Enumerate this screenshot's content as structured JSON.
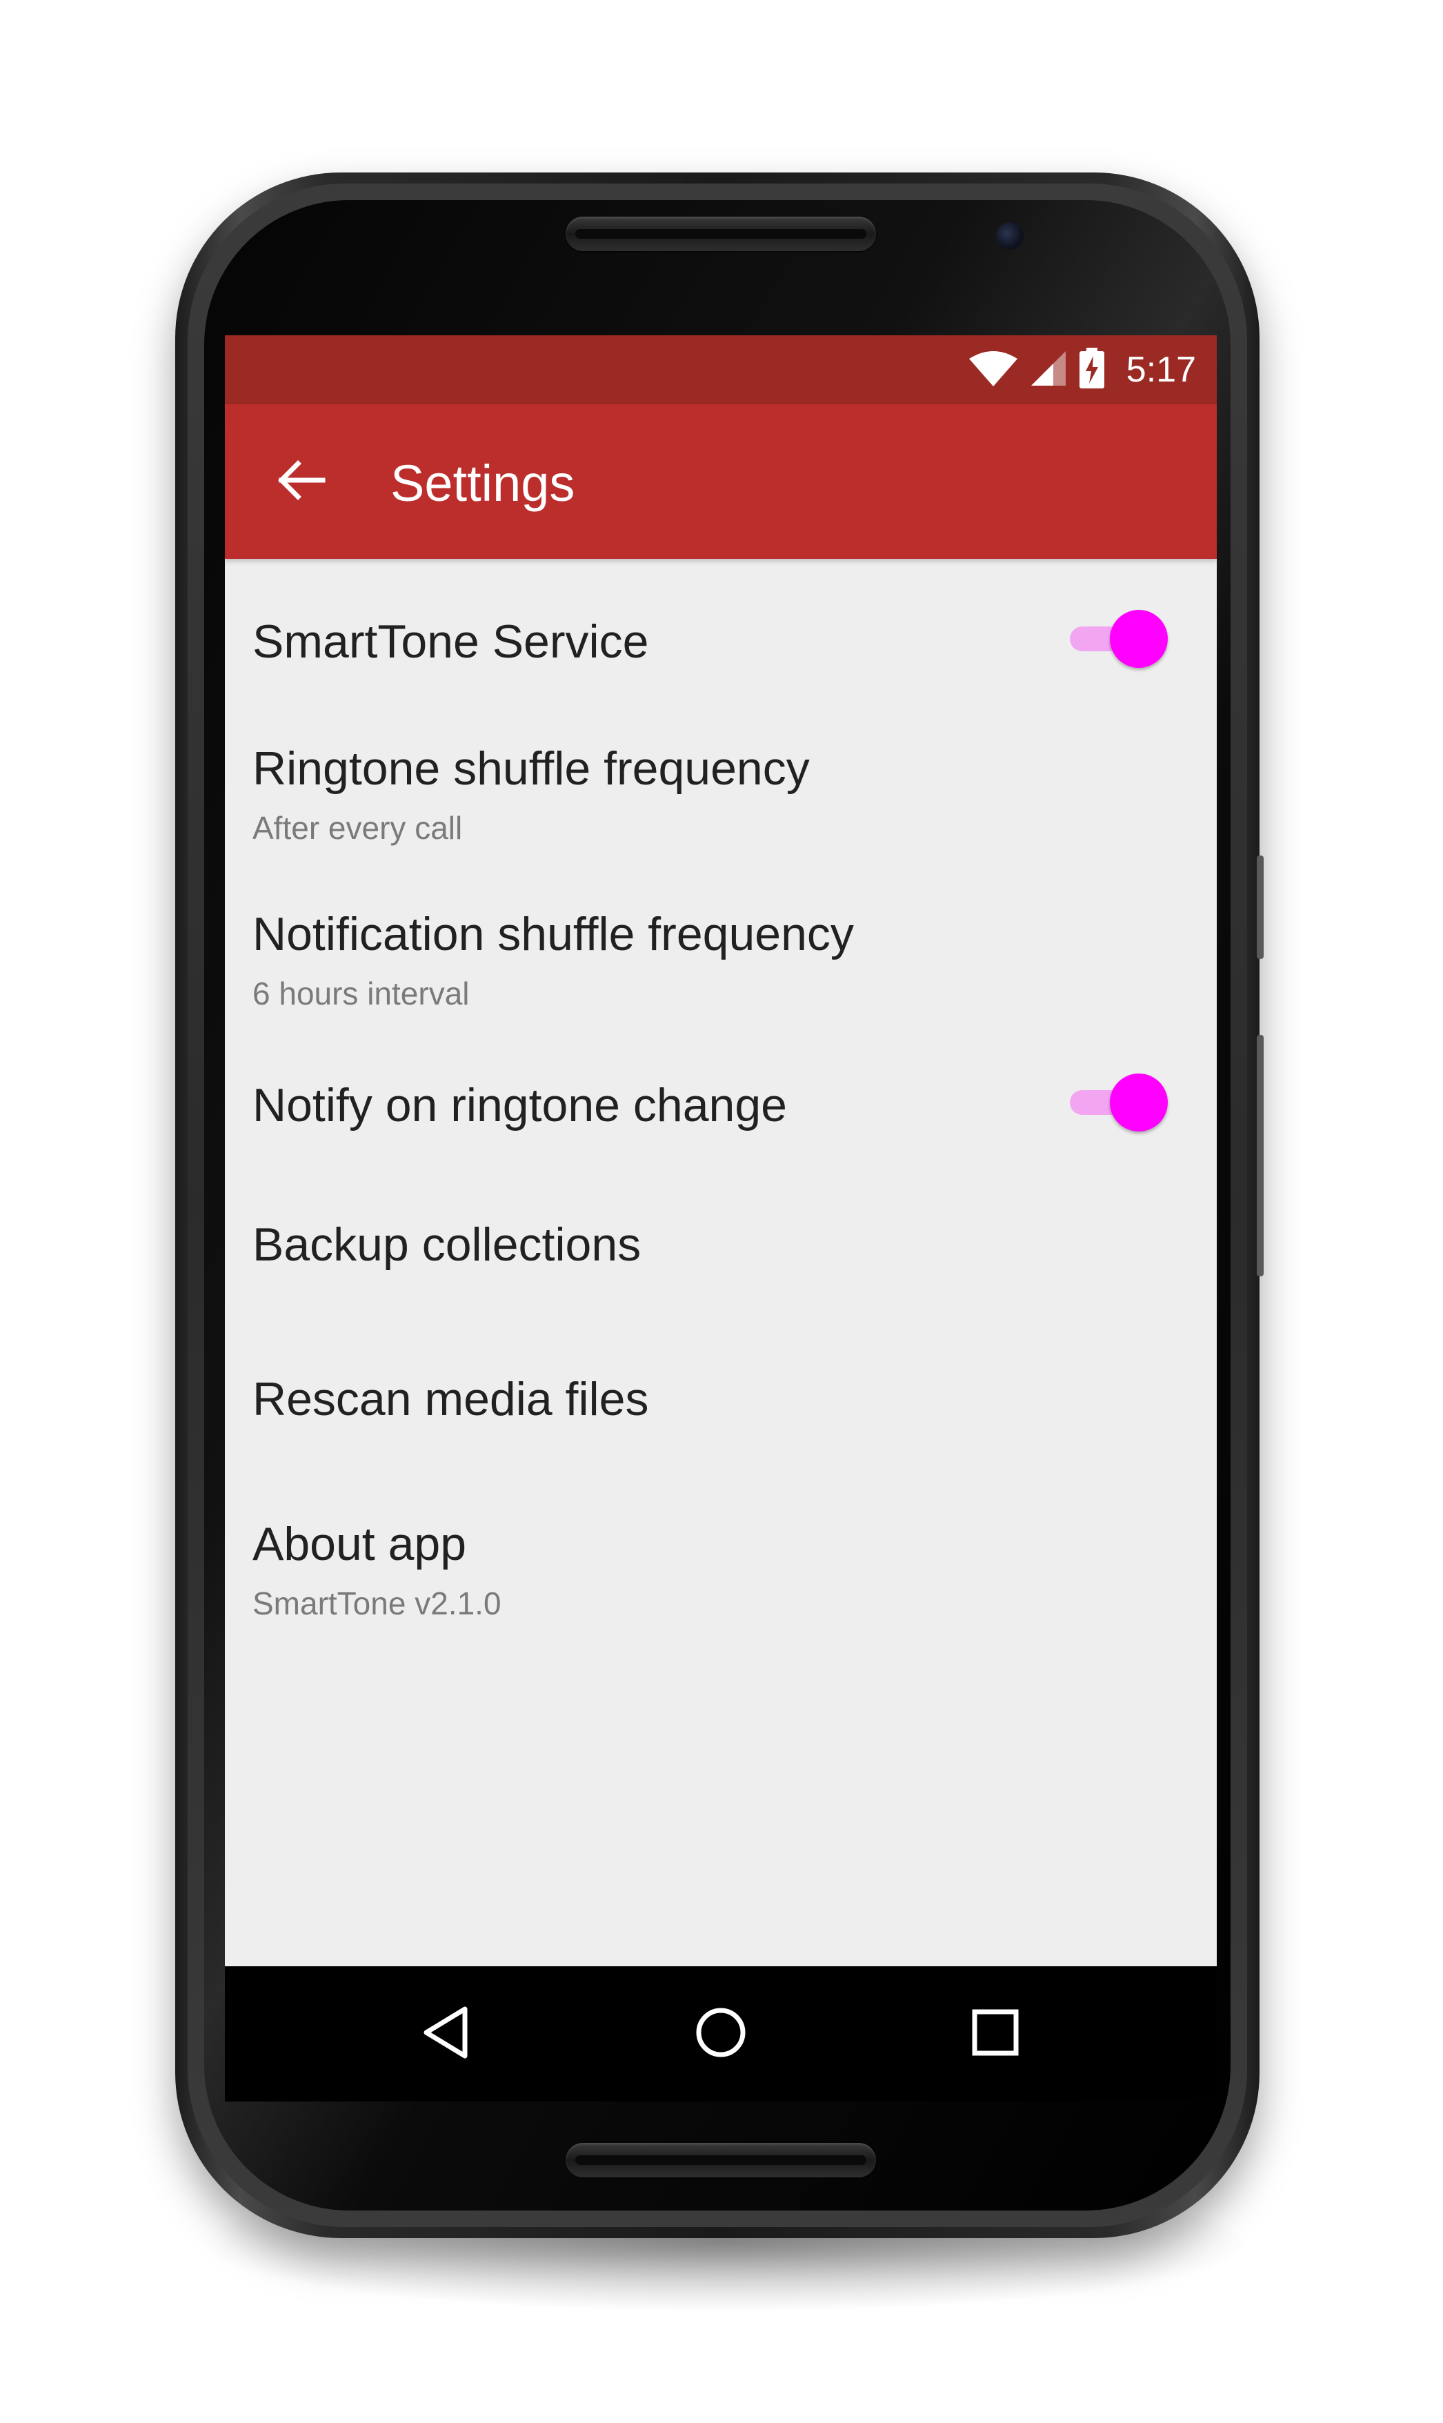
{
  "status_bar": {
    "time": "5:17",
    "icons": [
      "wifi-icon",
      "cell-signal-icon",
      "battery-charging-icon"
    ],
    "color": "#9c2a24"
  },
  "app_bar": {
    "title": "Settings",
    "back_icon": "arrow-back-icon",
    "color": "#bb2e2c"
  },
  "settings": {
    "items": [
      {
        "title": "SmartTone Service",
        "summary": "",
        "switch": true
      },
      {
        "title": "Ringtone shuffle frequency",
        "summary": "After every call"
      },
      {
        "title": "Notification shuffle frequency",
        "summary": "6 hours interval"
      },
      {
        "title": "Notify on ringtone change",
        "summary": "",
        "switch": true
      },
      {
        "title": "Backup collections",
        "summary": ""
      },
      {
        "title": "Rescan media files",
        "summary": ""
      },
      {
        "title": "About app",
        "summary": "SmartTone v2.1.0"
      }
    ]
  },
  "switch_colors": {
    "thumb": "#ff00ff",
    "track": "#f2a6f2"
  },
  "nav_bar": {
    "buttons": [
      "back-triangle-icon",
      "home-circle-icon",
      "recents-square-icon"
    ]
  }
}
